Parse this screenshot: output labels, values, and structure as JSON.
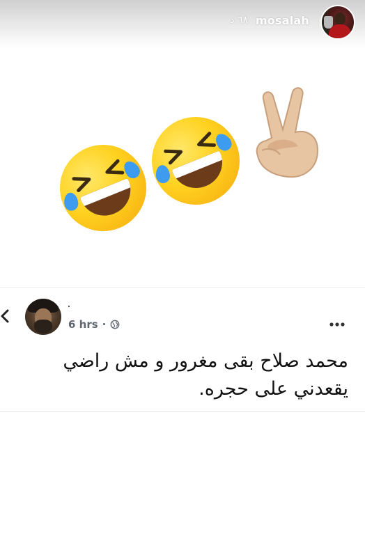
{
  "story": {
    "username": "mosalah",
    "time_ago": "٦٨ د"
  },
  "emojis": {
    "items": [
      "rolling-on-floor-laughing",
      "rolling-on-floor-laughing",
      "victory-hand-light-skin"
    ],
    "colors": {
      "face": "#ffd21f",
      "tear": "#3d9cf0",
      "skin": "#e7c4a2"
    }
  },
  "post": {
    "time": "6 hrs",
    "separator": "·",
    "audience_icon": "globe-icon",
    "text_line_1": "محمد صلاح بقى مغرور و مش راضي",
    "text_line_2": "يقعدني على حجره."
  }
}
